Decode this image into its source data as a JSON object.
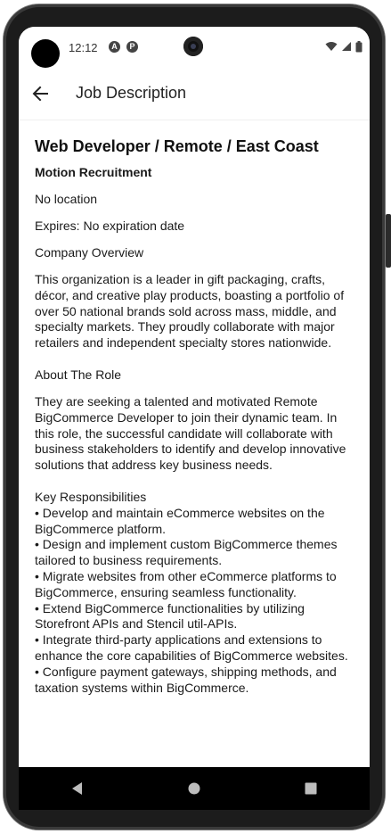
{
  "status_bar": {
    "time": "12:12",
    "icon_a": "A",
    "icon_b": "P"
  },
  "app_bar": {
    "title": "Job Description"
  },
  "job": {
    "title": "Web Developer / Remote / East Coast",
    "company": "Motion Recruitment",
    "location": "No location",
    "expires": "Expires: No expiration date",
    "company_overview_label": "Company Overview",
    "company_overview_text": "This organization is a leader in gift packaging, crafts, décor, and creative play products, boasting a portfolio of over 50 national brands sold across mass, middle, and specialty markets. They proudly collaborate with major retailers and independent specialty stores nationwide.",
    "about_role_label": "About The Role",
    "about_role_text": "They are seeking a talented and motivated Remote BigCommerce Developer to join their dynamic team. In this role, the successful candidate will collaborate with business stakeholders to identify and develop innovative solutions that address key business needs.",
    "responsibilities_label": "Key Responsibilities",
    "responsibilities": [
      "• Develop and maintain eCommerce websites on the BigCommerce platform.",
      "• Design and implement custom BigCommerce themes tailored to business requirements.",
      "• Migrate websites from other eCommerce platforms to BigCommerce, ensuring seamless functionality.",
      "• Extend BigCommerce functionalities by utilizing Storefront APIs and Stencil util-APIs.",
      "• Integrate third-party applications and extensions to enhance the core capabilities of BigCommerce websites.",
      "• Configure payment gateways, shipping methods, and taxation systems within BigCommerce."
    ]
  },
  "icons": {
    "back": "arrow-left-icon",
    "wifi": "wifi-icon",
    "signal": "cell-signal-icon",
    "battery": "battery-icon",
    "nav_back": "triangle-back-icon",
    "nav_home": "circle-home-icon",
    "nav_recents": "square-recents-icon"
  },
  "colors": {
    "nav_bar": "#000000",
    "text": "#1a1a1a",
    "frame": "#1c1c1c"
  }
}
